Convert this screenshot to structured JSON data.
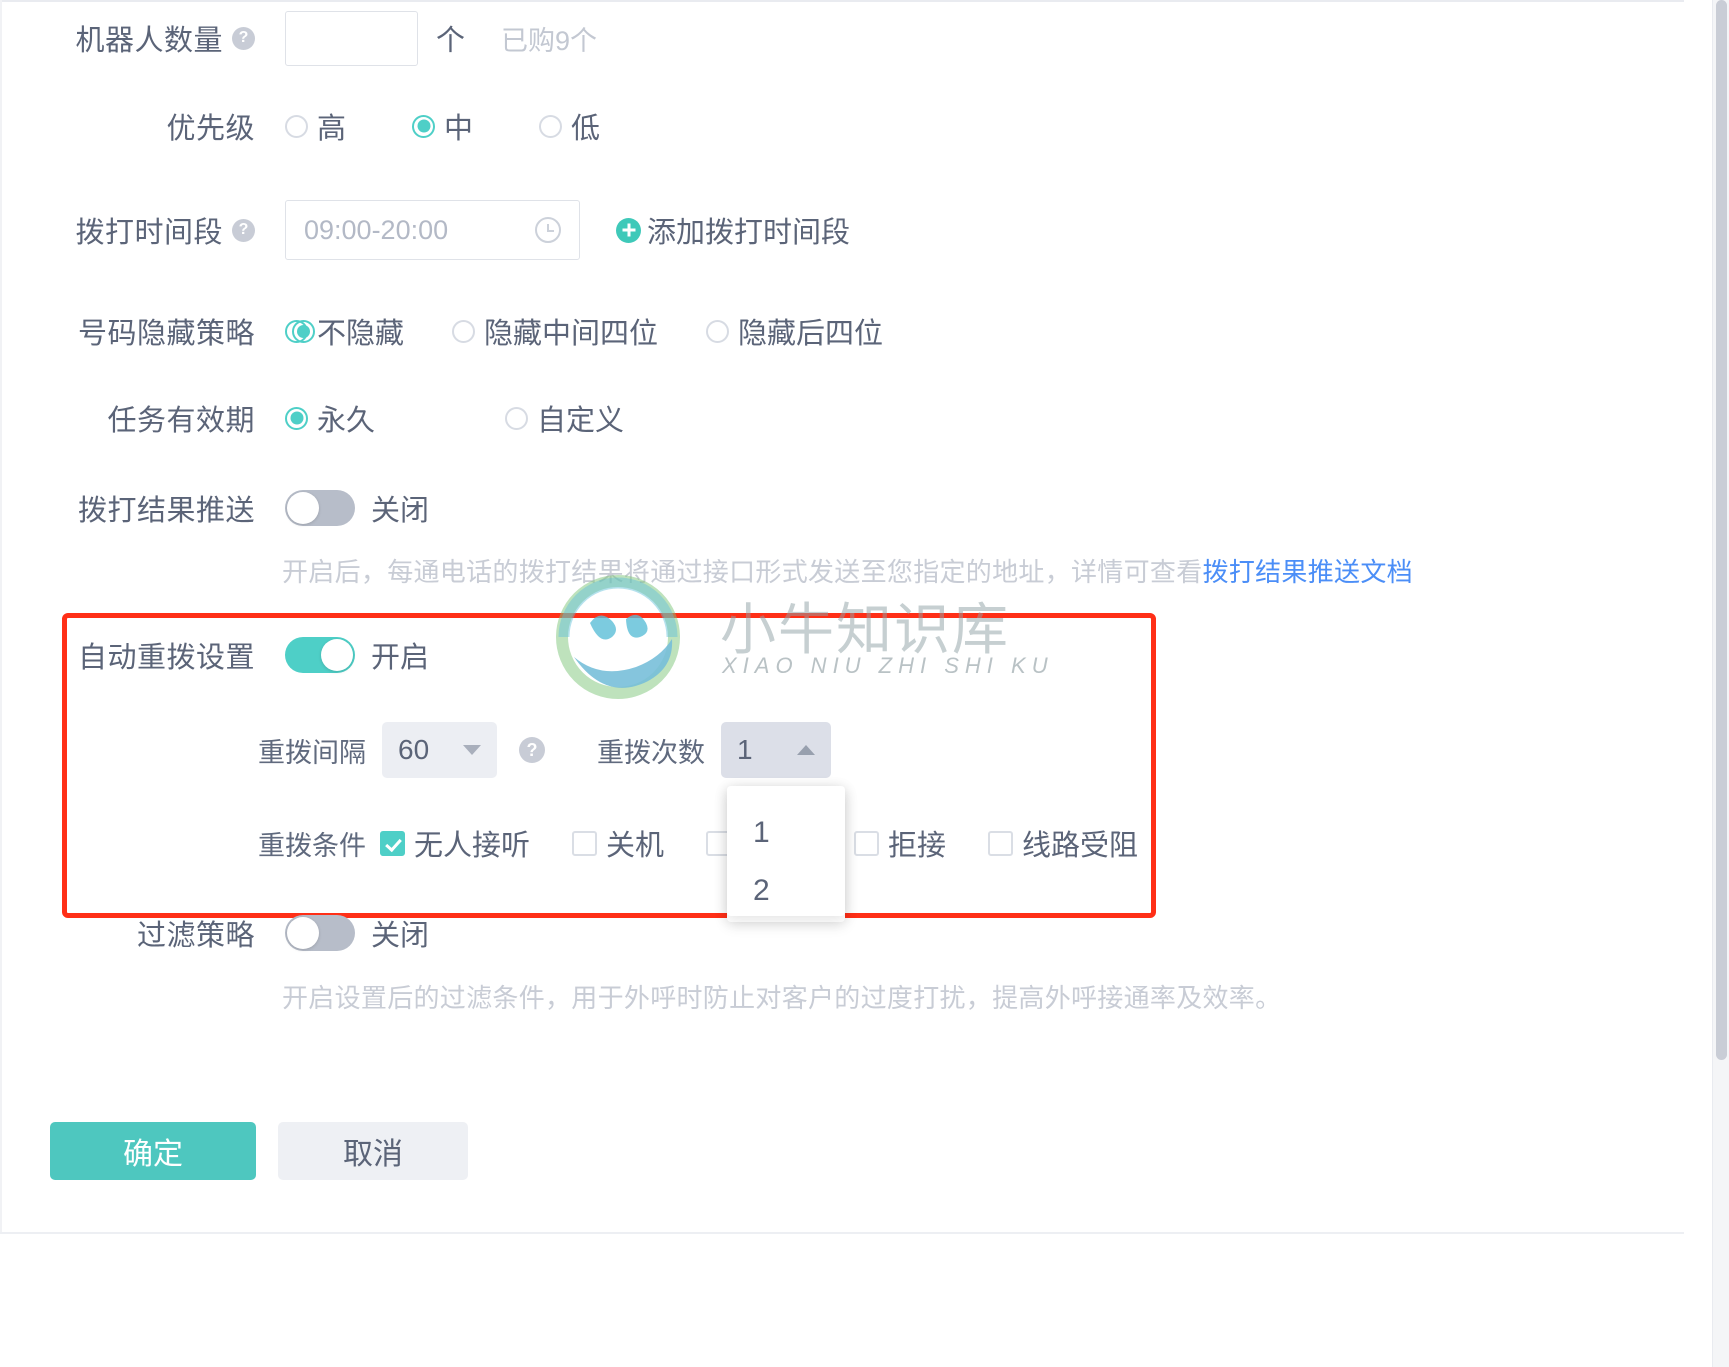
{
  "form": {
    "robot_count": {
      "label": "机器人数量",
      "value": "",
      "placeholder": "",
      "unit": "个",
      "note": "已购9个",
      "help_icon": "help-icon"
    },
    "priority": {
      "label": "优先级",
      "options": [
        {
          "label": "高",
          "selected": false
        },
        {
          "label": "中",
          "selected": true
        },
        {
          "label": "低",
          "selected": false
        }
      ]
    },
    "call_time_range": {
      "label": "拨打时间段",
      "value": "09:00-20:00",
      "clock_icon": "clock-icon",
      "add_link": "添加拨打时间段",
      "add_icon": "plus-circle-icon"
    },
    "number_hide_policy": {
      "label": "号码隐藏策略",
      "options": [
        {
          "label": "不隐藏",
          "selected": true
        },
        {
          "label": "隐藏中间四位",
          "selected": false
        },
        {
          "label": "隐藏后四位",
          "selected": false
        }
      ]
    },
    "task_validity": {
      "label": "任务有效期",
      "options": [
        {
          "label": "永久",
          "selected": true
        },
        {
          "label": "自定义",
          "selected": false
        }
      ]
    },
    "result_push": {
      "label": "拨打结果推送",
      "state_label": "关闭",
      "on": false,
      "desc_before": "开启后，每通电话的拨打结果将通过接口形式发送至您指定的地址，详情可查看",
      "desc_link": "拨打结果推送文档"
    },
    "auto_redial": {
      "label": "自动重拨设置",
      "state_label": "开启",
      "on": true,
      "interval": {
        "label": "重拨间隔",
        "value": "60",
        "help_icon": "help-icon",
        "caret": "chevron-down-icon"
      },
      "times": {
        "label": "重拨次数",
        "value": "1",
        "caret": "chevron-up-icon",
        "open": true,
        "options": [
          "1",
          "2"
        ]
      },
      "conditions": {
        "label": "重拨条件",
        "items": [
          {
            "label": "无人接听",
            "checked": true
          },
          {
            "label": "关机",
            "checked": false
          },
          {
            "label": "",
            "checked": false
          },
          {
            "label": "拒接",
            "checked": false
          },
          {
            "label": "线路受阻",
            "checked": false
          }
        ]
      }
    },
    "filter_policy": {
      "label": "过滤策略",
      "state_label": "关闭",
      "on": false,
      "desc": "开启设置后的过滤条件，用于外呼时防止对客户的过度打扰，提高外呼接通率及效率。"
    }
  },
  "footer": {
    "confirm_label": "确定",
    "cancel_label": "取消"
  },
  "watermark": {
    "title": "小牛知识库",
    "subtitle": "XIAO NIU ZHI SHI KU"
  },
  "colors": {
    "accent": "#4ecfc7",
    "primary_button": "#4ec7bf",
    "link": "#4b8ef7",
    "highlight_box": "#ff2f17",
    "text": "#5b6478",
    "muted": "#c8ccd5"
  }
}
